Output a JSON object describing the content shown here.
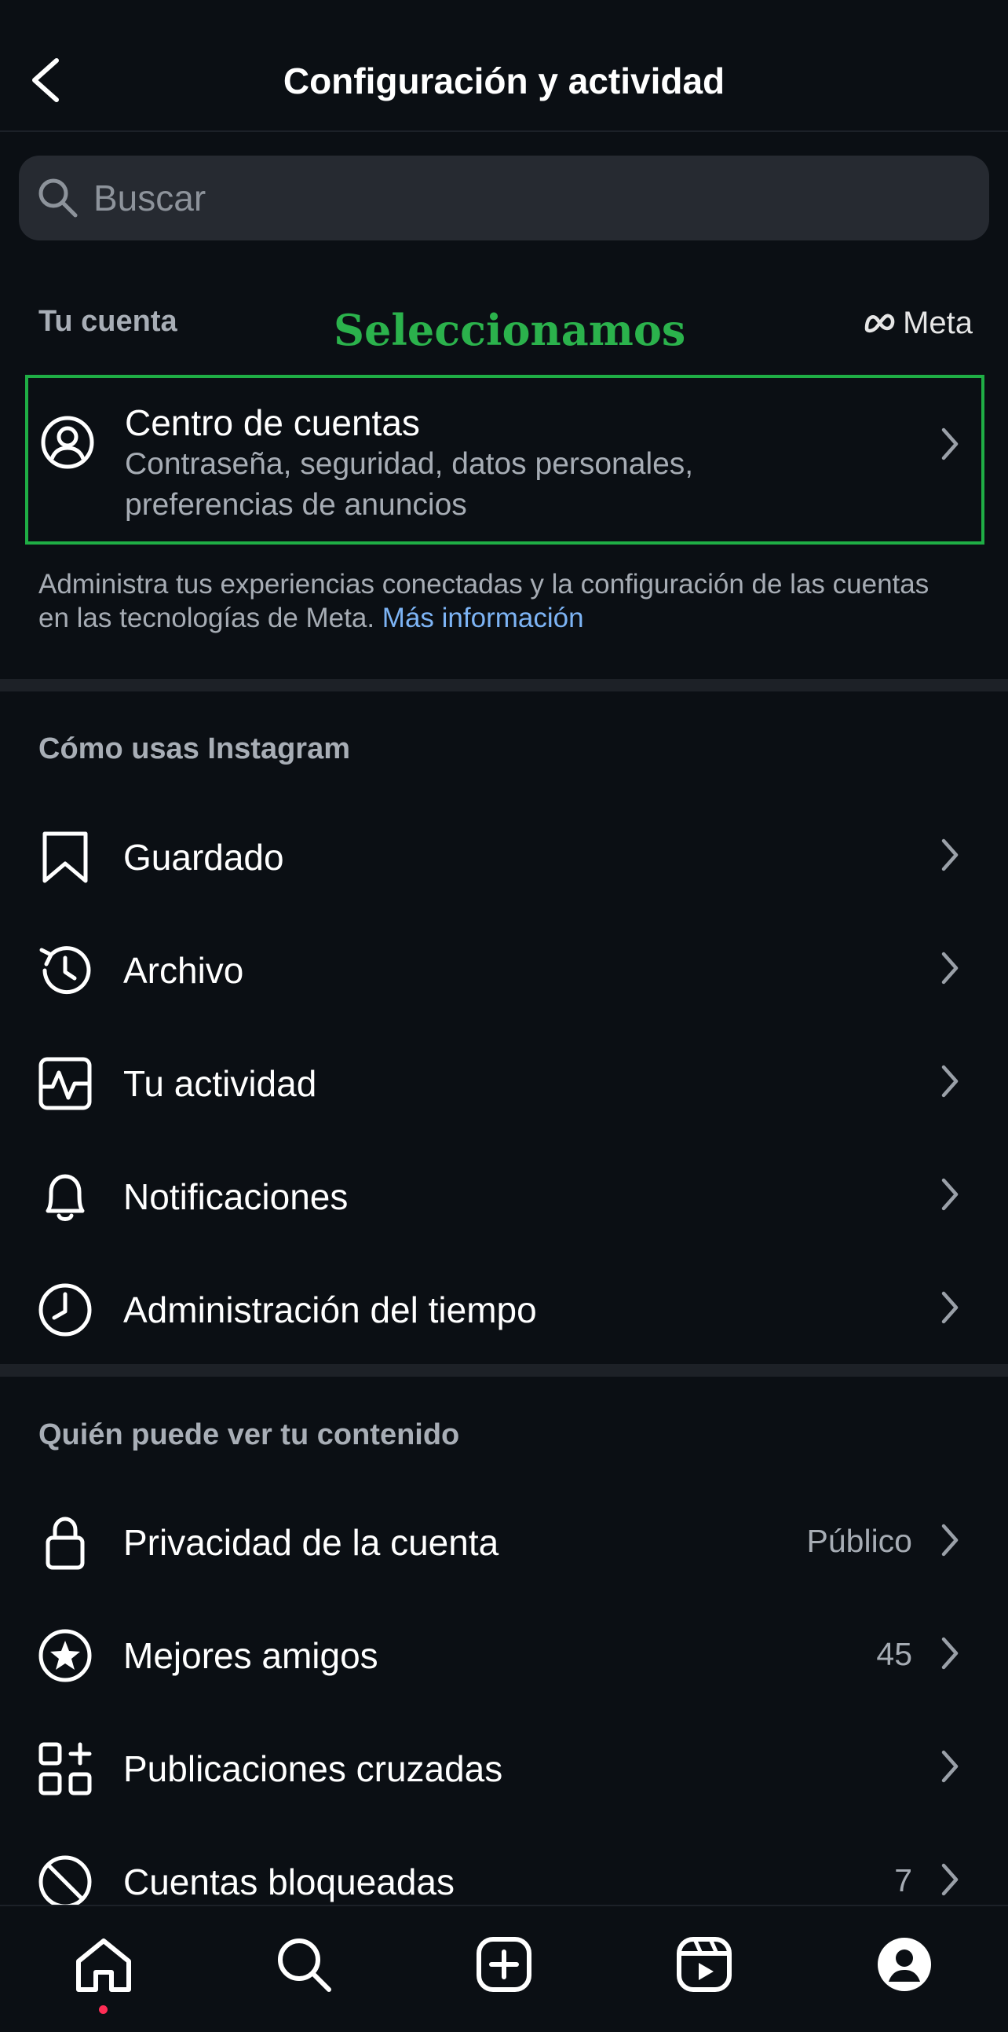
{
  "header": {
    "title": "Configuración y actividad",
    "back_icon": "chevron-left-icon"
  },
  "search": {
    "placeholder": "Buscar",
    "icon": "search-icon"
  },
  "account_section": {
    "label": "Tu cuenta",
    "annotation": "Seleccionamos",
    "brand": "Meta",
    "centro": {
      "title": "Centro de cuentas",
      "subtitle_line1": "Contraseña, seguridad, datos personales,",
      "subtitle_line2": "preferencias de anuncios"
    },
    "helper_text": "Administra tus experiencias conectadas y la configuración de las cuentas en las tecnologías de Meta.",
    "helper_link": "Más información",
    "annotation_color": "#2bb24c"
  },
  "usage_section": {
    "label": "Cómo usas Instagram",
    "items": [
      {
        "label": "Guardado",
        "icon": "bookmark-icon"
      },
      {
        "label": "Archivo",
        "icon": "history-icon"
      },
      {
        "label": "Tu actividad",
        "icon": "activity-icon"
      },
      {
        "label": "Notificaciones",
        "icon": "bell-icon"
      },
      {
        "label": "Administración del tiempo",
        "icon": "clock-icon"
      }
    ]
  },
  "visibility_section": {
    "label": "Quién puede ver tu contenido",
    "items": [
      {
        "label": "Privacidad de la cuenta",
        "value": "Público",
        "icon": "lock-icon"
      },
      {
        "label": "Mejores amigos",
        "value": "45",
        "icon": "star-circle-icon"
      },
      {
        "label": "Publicaciones cruzadas",
        "value": "",
        "icon": "grid-plus-icon"
      },
      {
        "label": "Cuentas bloqueadas",
        "value": "7",
        "icon": "blocked-icon"
      }
    ]
  },
  "tabbar": {
    "tabs": [
      "home-icon",
      "search-icon",
      "create-icon",
      "reels-icon",
      "profile-icon"
    ],
    "notification_dot_color": "#ff2d55"
  }
}
